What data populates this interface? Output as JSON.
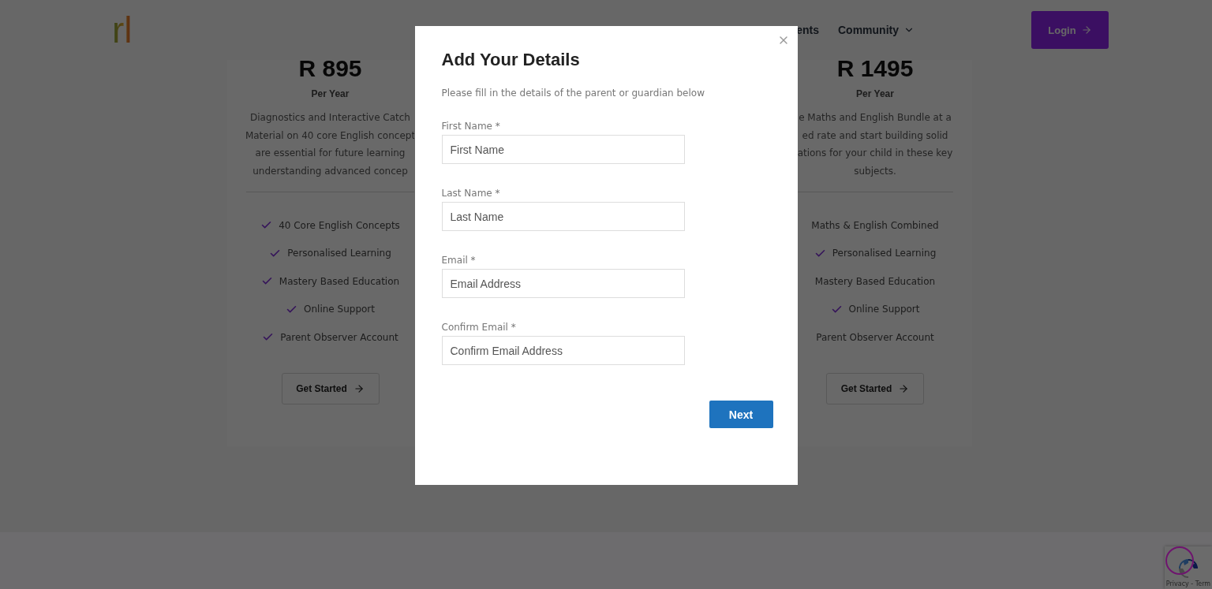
{
  "header": {
    "logo": "rl",
    "nav": [
      {
        "label": "ents",
        "dropdown": false
      },
      {
        "label": "Community",
        "dropdown": true
      }
    ],
    "login": "Login"
  },
  "cards": [
    {
      "price": "R 895",
      "period": "Per Year",
      "description": [
        "Diagnostics and Interactive Catch",
        "Material on 40 core English concept",
        "are essential for future learning",
        "understanding advanced concep"
      ],
      "features": [
        {
          "label": "40 Core English Concepts",
          "checked": true
        },
        {
          "label": "Personalised Learning",
          "checked": true
        },
        {
          "label": "Mastery Based Education",
          "checked": true
        },
        {
          "label": "Online Support",
          "checked": true
        },
        {
          "label": "Parent Observer Account",
          "checked": true
        }
      ],
      "button": "Get Started"
    },
    {
      "price": "R 1495",
      "period": "Per Year",
      "description": [
        "e Maths and English Bundle at a",
        "ed rate and start building solid",
        "ations for your child in these key",
        "subjects."
      ],
      "features": [
        {
          "label": "Maths & English Combined",
          "checked": false
        },
        {
          "label": "Personalised Learning",
          "checked": true
        },
        {
          "label": "Mastery Based Education",
          "checked": false
        },
        {
          "label": "Online Support",
          "checked": true
        },
        {
          "label": "Parent Observer Account",
          "checked": false
        }
      ],
      "button": "Get Started"
    }
  ],
  "modal": {
    "title": "Add Your Details",
    "subtitle": "Please fill in the details of the parent or guardian below",
    "fields": [
      {
        "label": "First Name *",
        "placeholder": "First Name"
      },
      {
        "label": "Last Name *",
        "placeholder": "Last Name"
      },
      {
        "label": "Email *",
        "placeholder": "Email Address"
      },
      {
        "label": "Confirm Email *",
        "placeholder": "Confirm Email Address"
      }
    ],
    "next": "Next"
  },
  "recaptcha": {
    "links": "Privacy - Term"
  }
}
